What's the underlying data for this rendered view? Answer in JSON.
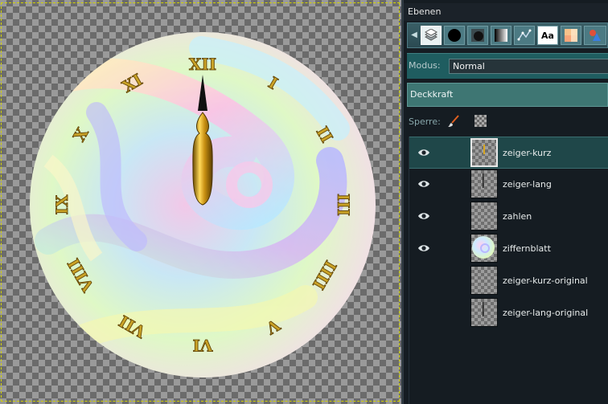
{
  "layers_panel": {
    "title": "Ebenen",
    "tabs": [
      {
        "icon": "layers-stack-icon",
        "active": true
      },
      {
        "icon": "brush-circle-icon"
      },
      {
        "icon": "pattern-icon"
      },
      {
        "icon": "gradient-icon"
      },
      {
        "icon": "paths-icon"
      },
      {
        "icon": "font-icon",
        "text": "Aa"
      },
      {
        "icon": "palette-icon"
      },
      {
        "icon": "shapes-icon"
      }
    ],
    "mode_label": "Modus:",
    "mode_value": "Normal",
    "opacity_label": "Deckkraft",
    "lock_label": "Sperre:",
    "layers": [
      {
        "name": "zeiger-kurz",
        "visible": true,
        "selected": true,
        "thumb": "short-hand"
      },
      {
        "name": "zeiger-lang",
        "visible": true,
        "selected": false,
        "thumb": "long-hand"
      },
      {
        "name": "zahlen",
        "visible": true,
        "selected": false,
        "thumb": "empty"
      },
      {
        "name": "ziffernblatt",
        "visible": true,
        "selected": false,
        "thumb": "dial"
      },
      {
        "name": "zeiger-kurz-original",
        "visible": false,
        "selected": false,
        "thumb": "empty"
      },
      {
        "name": "zeiger-lang-original",
        "visible": false,
        "selected": false,
        "thumb": "long-hand"
      }
    ]
  },
  "clock": {
    "numerals": [
      "XII",
      "I",
      "II",
      "III",
      "IIII",
      "V",
      "VI",
      "VII",
      "VIII",
      "IX",
      "X",
      "XI"
    ],
    "time": "12:00"
  },
  "colors": {
    "accent": "#3e7673",
    "selection": "#1f4749",
    "numeral_gold": "#c9a227"
  }
}
